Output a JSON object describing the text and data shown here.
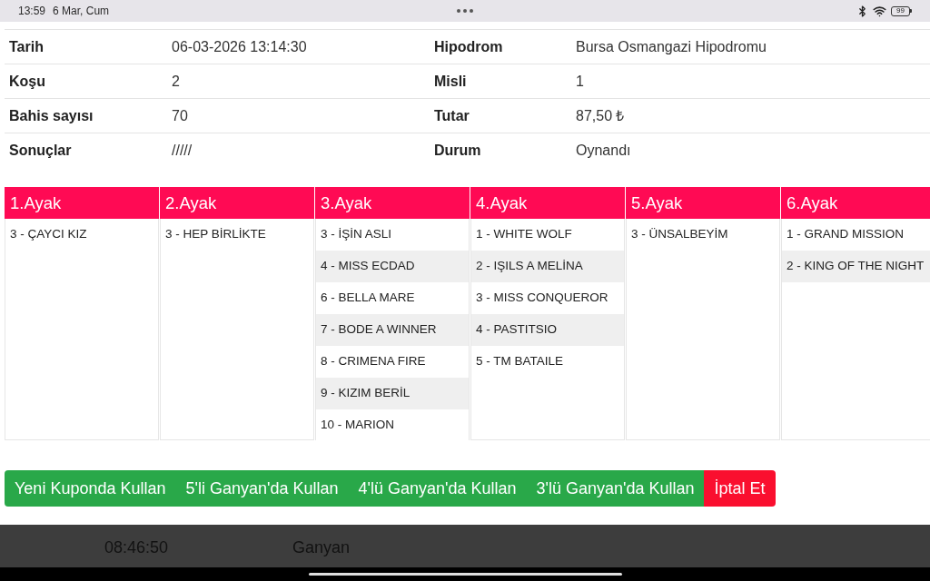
{
  "status_bar": {
    "time": "13:59",
    "date": "6 Mar, Cum",
    "battery": "99"
  },
  "details": {
    "rows": [
      {
        "cells": [
          {
            "label": "Tarih",
            "value": "06-03-2026 13:14:30"
          },
          {
            "label": "Hipodrom",
            "value": "Bursa Osmangazi Hipodromu"
          }
        ]
      },
      {
        "cells": [
          {
            "label": "Koşu",
            "value": "2"
          },
          {
            "label": "Misli",
            "value": "1"
          }
        ]
      },
      {
        "cells": [
          {
            "label": "Bahis sayısı",
            "value": "70"
          },
          {
            "label": "Tutar",
            "value": "87,50 ₺"
          }
        ]
      },
      {
        "cells": [
          {
            "label": "Sonuçlar",
            "value": "/////"
          },
          {
            "label": "Durum",
            "value": "Oynandı"
          }
        ]
      }
    ]
  },
  "legs": [
    {
      "title": "1.Ayak",
      "horses": [
        "3 - ÇAYCI KIZ"
      ]
    },
    {
      "title": "2.Ayak",
      "horses": [
        "3 - HEP BİRLİKTE"
      ]
    },
    {
      "title": "3.Ayak",
      "horses": [
        "3 - İŞİN ASLI",
        "4 - MISS ECDAD",
        "6 - BELLA MARE",
        "7 - BODE A WINNER",
        "8 - CRIMENA FIRE",
        "9 - KIZIM BERİL",
        "10 - MARION"
      ]
    },
    {
      "title": "4.Ayak",
      "horses": [
        "1 - WHITE WOLF",
        "2 - IŞILS A MELİNA",
        "3 - MISS CONQUEROR",
        "4 - PASTITSIO",
        "5 - TM BATAILE"
      ]
    },
    {
      "title": "5.Ayak",
      "horses": [
        "3 - ÜNSALBEYİM"
      ]
    },
    {
      "title": "6.Ayak",
      "horses": [
        "1 - GRAND MISSION",
        "2 - KING OF THE NIGHT"
      ]
    }
  ],
  "actions": [
    {
      "label": "Yeni Kuponda Kullan",
      "kind": "primary"
    },
    {
      "label": "5'li Ganyan'da Kullan",
      "kind": "primary"
    },
    {
      "label": "4'lü Ganyan'da Kullan",
      "kind": "primary"
    },
    {
      "label": "3'lü Ganyan'da Kullan",
      "kind": "primary"
    },
    {
      "label": "İptal Et",
      "kind": "danger"
    }
  ],
  "background_row": [
    {
      "text": "08:46:50"
    },
    {
      "text": "Ganyan"
    }
  ]
}
